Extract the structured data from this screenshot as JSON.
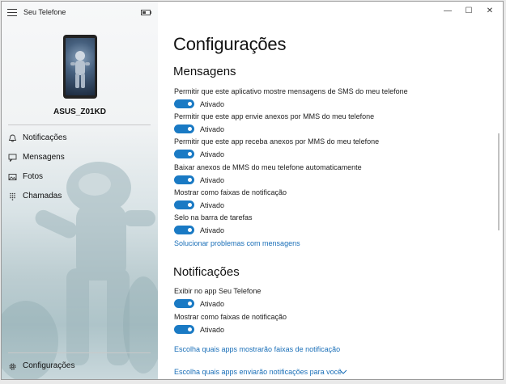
{
  "app": {
    "title": "Seu Telefone"
  },
  "device": {
    "name": "ASUS_Z01KD"
  },
  "nav": {
    "items": [
      {
        "label": "Notificações",
        "icon": "bell-icon"
      },
      {
        "label": "Mensagens",
        "icon": "message-icon"
      },
      {
        "label": "Fotos",
        "icon": "photo-icon"
      },
      {
        "label": "Chamadas",
        "icon": "dialpad-icon"
      }
    ],
    "settings_label": "Configurações"
  },
  "window_controls": {
    "minimize": "—",
    "maximize": "☐",
    "close": "✕"
  },
  "page": {
    "title": "Configurações",
    "messages": {
      "title": "Mensagens",
      "settings": [
        {
          "label": "Permitir que este aplicativo mostre mensagens de SMS do meu telefone",
          "state": "Ativado"
        },
        {
          "label": "Permitir que este app envie anexos por MMS do meu telefone",
          "state": "Ativado"
        },
        {
          "label": "Permitir que este app receba anexos por MMS do meu telefone",
          "state": "Ativado"
        },
        {
          "label": "Baixar anexos de MMS do meu telefone automaticamente",
          "state": "Ativado"
        },
        {
          "label": "Mostrar como faixas de notificação",
          "state": "Ativado"
        },
        {
          "label": "Selo na barra de tarefas",
          "state": "Ativado"
        }
      ],
      "link": "Solucionar problemas com mensagens"
    },
    "notifications": {
      "title": "Notificações",
      "settings": [
        {
          "label": "Exibir no app Seu Telefone",
          "state": "Ativado"
        },
        {
          "label": "Mostrar como faixas de notificação",
          "state": "Ativado"
        }
      ],
      "link1": "Escolha quais apps mostrarão faixas de notificação",
      "link2": "Escolha quais apps enviarão notificações para você"
    }
  },
  "colors": {
    "accent": "#1a7ac4",
    "link": "#1a6fb8"
  }
}
